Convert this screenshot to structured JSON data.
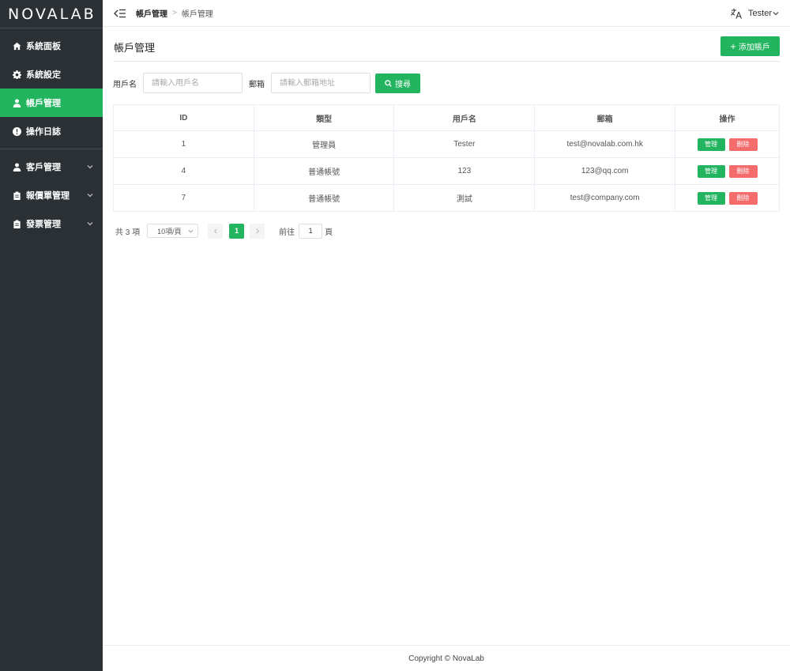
{
  "app": {
    "logo": "NOVALAB"
  },
  "sidebar": {
    "groups": [
      {
        "items": [
          {
            "label": "系統面板",
            "icon": "home-icon"
          },
          {
            "label": "系統設定",
            "icon": "gear-icon"
          },
          {
            "label": "帳戶管理",
            "icon": "user-icon",
            "active": true
          },
          {
            "label": "操作日誌",
            "icon": "alert-icon"
          }
        ]
      },
      {
        "items": [
          {
            "label": "客戶管理",
            "icon": "user-icon"
          },
          {
            "label": "報價單管理",
            "icon": "clipboard-icon"
          },
          {
            "label": "發票管理",
            "icon": "clipboard-icon"
          }
        ]
      }
    ]
  },
  "header": {
    "breadcrumb": [
      "帳戶管理",
      "帳戶管理"
    ],
    "user": "Tester"
  },
  "page": {
    "title": "帳戶管理",
    "add_button": "添加賬戶"
  },
  "search": {
    "username_label": "用戶名",
    "username_placeholder": "請輸入用戶名",
    "email_label": "郵箱",
    "email_placeholder": "請輸入郵箱地址",
    "button": "搜尋"
  },
  "table": {
    "columns": [
      "ID",
      "類型",
      "用戶名",
      "郵箱",
      "操作"
    ],
    "rows": [
      {
        "id": "1",
        "type": "管理員",
        "username": "Tester",
        "email": "test@novalab.com.hk"
      },
      {
        "id": "4",
        "type": "普通帳號",
        "username": "123",
        "email": "123@qq.com"
      },
      {
        "id": "7",
        "type": "普通帳號",
        "username": "測試",
        "email": "test@company.com"
      }
    ],
    "manage_label": "管理",
    "delete_label": "刪除"
  },
  "pagination": {
    "total": "共 3 項",
    "page_size": "10項/頁",
    "current_page": "1",
    "goto_label": "前往",
    "goto_value": "1",
    "goto_suffix": "頁"
  },
  "footer": {
    "copyright": "Copyright © NovaLab"
  },
  "colors": {
    "accent": "#22b45e",
    "danger": "#f56c6c",
    "sidebar_bg": "#2b3034"
  }
}
